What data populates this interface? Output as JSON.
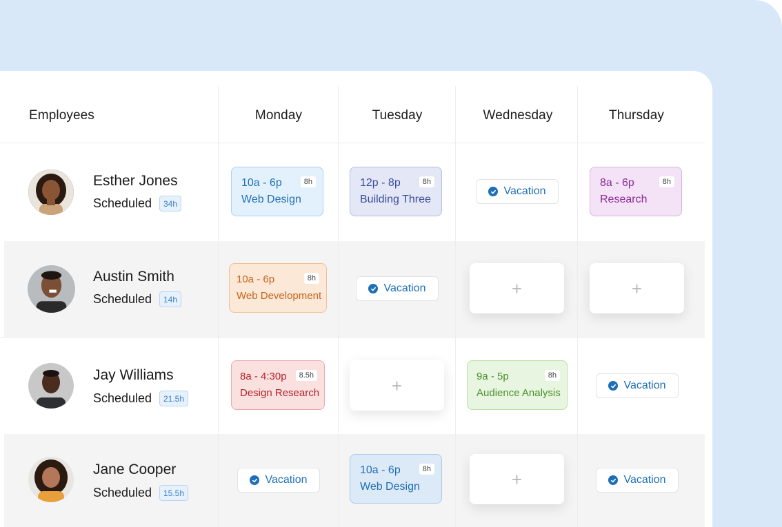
{
  "header": {
    "employees": "Employees",
    "days": [
      "Monday",
      "Tuesday",
      "Wednesday",
      "Thursday"
    ]
  },
  "employees": [
    {
      "name": "Esther Jones",
      "status": "Scheduled",
      "hours": "34h",
      "shifts": [
        {
          "type": "shift",
          "time": "10a - 6p",
          "duration": "8h",
          "place": "Web Design",
          "color": "#1e6fb8"
        },
        {
          "type": "shift",
          "time": "12p - 8p",
          "duration": "8h",
          "place": "Building Three",
          "color": "#3a4c9a"
        },
        {
          "type": "vacation",
          "label": "Vacation"
        },
        {
          "type": "shift",
          "time": "8a - 6p",
          "duration": "8h",
          "place": "Research",
          "color": "#8a2a95"
        }
      ]
    },
    {
      "name": "Austin Smith",
      "status": "Scheduled",
      "hours": "14h",
      "shifts": [
        {
          "type": "shift",
          "time": "10a - 6p",
          "duration": "8h",
          "place": "Web Development",
          "color": "#c8641a"
        },
        {
          "type": "vacation",
          "label": "Vacation"
        },
        {
          "type": "empty",
          "label": "+"
        },
        {
          "type": "empty",
          "label": "+"
        }
      ]
    },
    {
      "name": "Jay Williams",
      "status": "Scheduled",
      "hours": "21.5h",
      "shifts": [
        {
          "type": "shift",
          "time": "8a - 4:30p",
          "duration": "8.5h",
          "place": "Design Research",
          "color": "#b3242a"
        },
        {
          "type": "empty",
          "label": "+"
        },
        {
          "type": "shift",
          "time": "9a - 5p",
          "duration": "8h",
          "place": "Audience Analysis",
          "color": "#4b8f2a"
        },
        {
          "type": "vacation",
          "label": "Vacation"
        }
      ]
    },
    {
      "name": "Jane Cooper",
      "status": "Scheduled",
      "hours": "15.5h",
      "shifts": [
        {
          "type": "vacation",
          "label": "Vacation"
        },
        {
          "type": "shift",
          "time": "10a - 6p",
          "duration": "8h",
          "place": "Web Design",
          "color": "#1e6fb8"
        },
        {
          "type": "empty",
          "label": "+"
        },
        {
          "type": "vacation",
          "label": "Vacation"
        }
      ]
    }
  ],
  "icons": {
    "vacation": "check-circle-icon",
    "add": "plus-icon",
    "avatar": "avatar-photo"
  },
  "colors": {
    "background_panel": "#d8e8f8",
    "accent": "#1e6fb8"
  }
}
